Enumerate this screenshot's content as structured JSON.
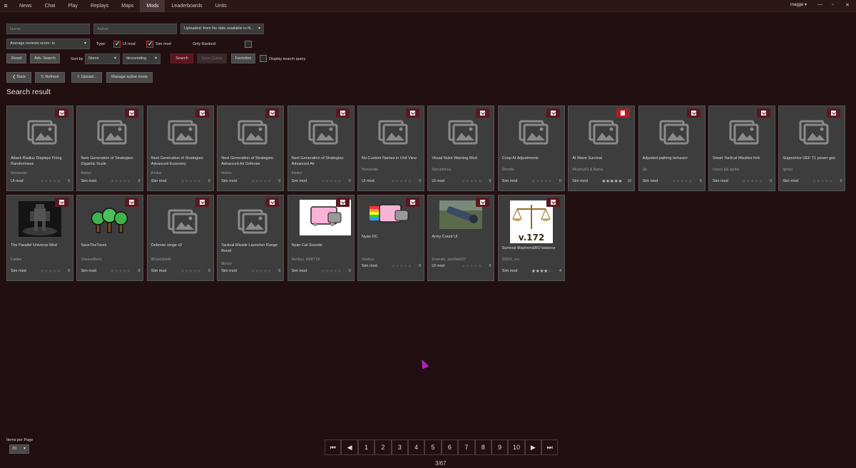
{
  "nav": {
    "tabs": [
      "News",
      "Chat",
      "Play",
      "Replays",
      "Maps",
      "Mods",
      "Leaderboards",
      "Units"
    ],
    "active": 5,
    "user": "magge ▾"
  },
  "filters": {
    "name_placeholder": "Name",
    "author_placeholder": "Author",
    "uploaded": "Uploaded: from No date available to N...",
    "avg_reviews": "Average reviews score: to",
    "type_label": "Type:",
    "ui_mod": "UI mod",
    "sim_mod": "Sim mod",
    "only_ranked": "Only Ranked:",
    "sort_by": "Sort by",
    "sort_field": "Name",
    "sort_order": "descending",
    "reset": "Reset",
    "adv_search": "Adv. Search",
    "search": "Search",
    "save_query": "Save Query",
    "favorites": "Favorites",
    "display_query": "Display search query"
  },
  "toolbar": {
    "back": "Back",
    "refresh": "Refresh",
    "upload": "Upload...",
    "manage": "Manage active mods"
  },
  "result_title": "Search result",
  "mods": [
    {
      "name": "Attack Radius Displays Firing Randomness",
      "author": "Nomander",
      "type": "UI mod",
      "rating": 0,
      "count": "0",
      "thumb": "placeholder",
      "action": "download"
    },
    {
      "name": "Next Generation of Strategies: Gigantic Scale",
      "author": "thinker",
      "type": "Sim mod",
      "rating": 0,
      "count": "0",
      "thumb": "placeholder",
      "action": "download"
    },
    {
      "name": "Next Generation of Strategies: Advanced Economy",
      "author": "thinker",
      "type": "Sim mod",
      "rating": 0,
      "count": "0",
      "thumb": "placeholder",
      "action": "download"
    },
    {
      "name": "Next Generation of Strategies: Advanced Air Defense",
      "author": "thinker",
      "type": "Sim mod",
      "rating": 0,
      "count": "0",
      "thumb": "placeholder",
      "action": "download"
    },
    {
      "name": "Next Generation of Strategies: Advanced Air",
      "author": "thinker",
      "type": "Sim mod",
      "rating": 0,
      "count": "0",
      "thumb": "placeholder",
      "action": "download"
    },
    {
      "name": "No Custom Names in Unit View",
      "author": "Nomander",
      "type": "UI mod",
      "rating": 0,
      "count": "0",
      "thumb": "placeholder",
      "action": "download"
    },
    {
      "name": "Visual Nuke Warning Mod",
      "author": "Sercammus",
      "type": "UI mod",
      "rating": 0,
      "count": "0",
      "thumb": "placeholder",
      "action": "download"
    },
    {
      "name": "Coop AI Adjustments",
      "author": "Dhomie",
      "type": "Sim mod",
      "rating": 0,
      "count": "0",
      "thumb": "placeholder",
      "action": "download"
    },
    {
      "name": "AI Wave Survival",
      "author": "AKarmy01 & Rama",
      "type": "Sim mod",
      "rating": 4.5,
      "count": "10",
      "thumb": "placeholder",
      "action": "delete"
    },
    {
      "name": "Adjusted pathing behavior",
      "author": "Jip",
      "type": "Sim mod",
      "rating": 0,
      "count": "0",
      "thumb": "placeholder",
      "action": "download"
    },
    {
      "name": "Smart Tactical Missiles fork",
      "author": "Uveso && Igniter",
      "type": "Sim mod",
      "rating": 0,
      "count": "0",
      "thumb": "placeholder",
      "action": "download"
    },
    {
      "name": "Supportive UEF T1 power gen",
      "author": "Igniter",
      "type": "Sim mod",
      "rating": 0,
      "count": "0",
      "thumb": "placeholder",
      "action": "download"
    },
    {
      "name": "The Parallel Universe Mod",
      "author": "Caliber",
      "type": "Sim mod",
      "rating": 0,
      "count": "0",
      "thumb": "robot",
      "action": "download"
    },
    {
      "name": "SaveTheTrees",
      "author": "CheeseBerry",
      "type": "Sim mod",
      "rating": 0,
      "count": "0",
      "thumb": "trees",
      "action": "download"
    },
    {
      "name": "Defense range x2",
      "author": "iltDarkSideltl",
      "type": "Sim mod",
      "rating": 0,
      "count": "0",
      "thumb": "placeholder",
      "action": "download"
    },
    {
      "name": "Tactical Missile Launcher Range Boost",
      "author": "Moose",
      "type": "Sim mod",
      "rating": 0,
      "count": "0",
      "thumb": "placeholder",
      "action": "download"
    },
    {
      "name": "Nyan Cat Sounds",
      "author": "Deribus, M2RT1N",
      "type": "Sim mod",
      "rating": 0,
      "count": "0",
      "thumb": "nyan",
      "action": "download"
    },
    {
      "name": "Nyan OC",
      "author": "Deribus",
      "type": "Sim mod",
      "rating": 0,
      "count": "0",
      "thumb": "nyan2",
      "action": "download"
    },
    {
      "name": "Army Count UI",
      "author": "Emerald, JamWat207",
      "type": "UI mod",
      "rating": 0,
      "count": "0",
      "thumb": "gun",
      "action": "download"
    },
    {
      "name": "Survival Mayhem&BO balance",
      "author": "DDDX_cro",
      "type": "Sim mod",
      "rating": 4,
      "count": "4",
      "thumb": "scales",
      "thumb_text": "v.172",
      "action": "download"
    }
  ],
  "pagination": {
    "pages": [
      "1",
      "2",
      "3",
      "4",
      "5",
      "6",
      "7",
      "8",
      "9",
      "10"
    ],
    "indicator": "3/67",
    "items_per_page_label": "Items per Page",
    "items_per_page": "20"
  }
}
